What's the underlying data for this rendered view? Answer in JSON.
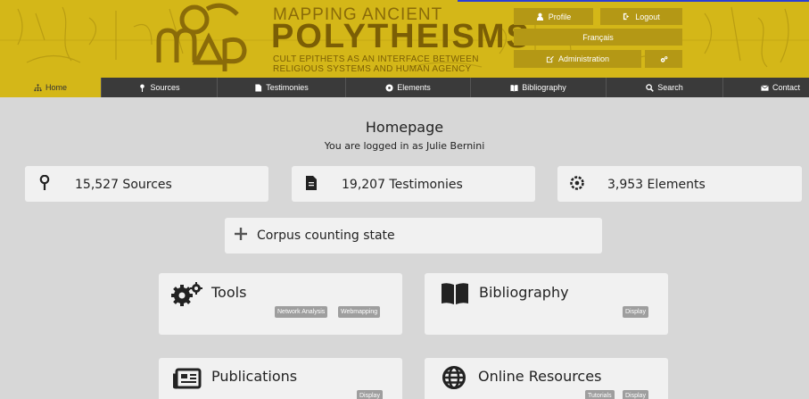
{
  "header": {
    "title_line1": "MAPPING ANCIENT",
    "title_line2": "POLYTHEISMS",
    "subtitle_line1": "CULT EPITHETS AS AN INTERFACE BETWEEN",
    "subtitle_line2": "RELIGIOUS SYSTEMS AND HUMAN AGENCY",
    "logo_text": "map",
    "profile_label": "Profile",
    "logout_label": "Logout",
    "language_label": "Français",
    "admin_label": "Administration",
    "colors": {
      "gold": "#d4b718",
      "button": "#b49815",
      "nav": "#3a3a3a"
    }
  },
  "nav": {
    "items": [
      {
        "label": "Home",
        "icon": "sitemap-icon"
      },
      {
        "label": "Sources",
        "icon": "pin-icon"
      },
      {
        "label": "Testimonies",
        "icon": "document-icon"
      },
      {
        "label": "Elements",
        "icon": "atom-icon"
      },
      {
        "label": "Bibliography",
        "icon": "book-icon"
      },
      {
        "label": "Search",
        "icon": "search-icon"
      },
      {
        "label": "Contact",
        "icon": "envelope-icon"
      }
    ]
  },
  "main": {
    "title": "Homepage",
    "logged_in_text": "You are logged in as Julie Bernini",
    "stats": [
      {
        "label": "15,527 Sources",
        "icon": "pin-icon"
      },
      {
        "label": "19,207 Testimonies",
        "icon": "document-icon"
      },
      {
        "label": "3,953 Elements",
        "icon": "atom-icon"
      }
    ],
    "corpus_label": "Corpus counting state",
    "tiles": {
      "tools": {
        "title": "Tools",
        "tags": [
          "Network Analysis",
          "Webmapping"
        ]
      },
      "bibliography": {
        "title": "Bibliography",
        "tags": [
          "Display"
        ]
      },
      "publications": {
        "title": "Publications",
        "tags": [
          "Display"
        ]
      },
      "online_resources": {
        "title": "Online Resources",
        "tags": [
          "Tutorials",
          "Display"
        ]
      }
    }
  }
}
